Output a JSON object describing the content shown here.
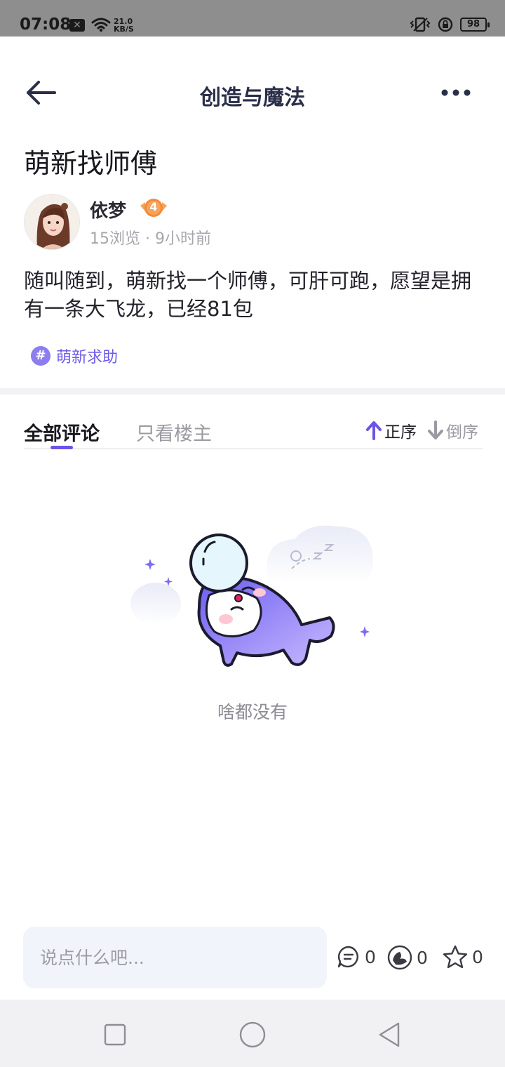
{
  "status_bar": {
    "time": "07:08",
    "notification_icon": "x-box-icon",
    "net_speed_value": "21.0",
    "net_speed_unit": "KB/S",
    "battery": "98"
  },
  "header": {
    "title": "创造与魔法",
    "back_icon": "arrow-left-icon",
    "more_icon": "more-horizontal-icon"
  },
  "post": {
    "title": "萌新找师傅",
    "author": {
      "name": "依梦",
      "level": "4"
    },
    "meta": "15浏览 · 9小时前",
    "body": "随叫随到，萌新找一个师傅，可肝可跑，愿望是拥有一条大飞龙，已经81包",
    "tag": {
      "icon": "#",
      "label": "萌新求助"
    }
  },
  "comments": {
    "tabs": [
      {
        "label": "全部评论",
        "active": true
      },
      {
        "label": "只看楼主",
        "active": false
      }
    ],
    "sort": {
      "ascending": "正序",
      "descending": "倒序",
      "selected": "正序"
    },
    "empty_text": "啥都没有"
  },
  "bottom_bar": {
    "input_placeholder": "说点什么吧...",
    "comment_count": "0",
    "like_count": "0",
    "favorite_count": "0"
  },
  "colors": {
    "accent": "#6a55e6",
    "tag": "#6d5ce8",
    "title_text": "#2a2e48",
    "input_bg": "#f2f4fb"
  }
}
